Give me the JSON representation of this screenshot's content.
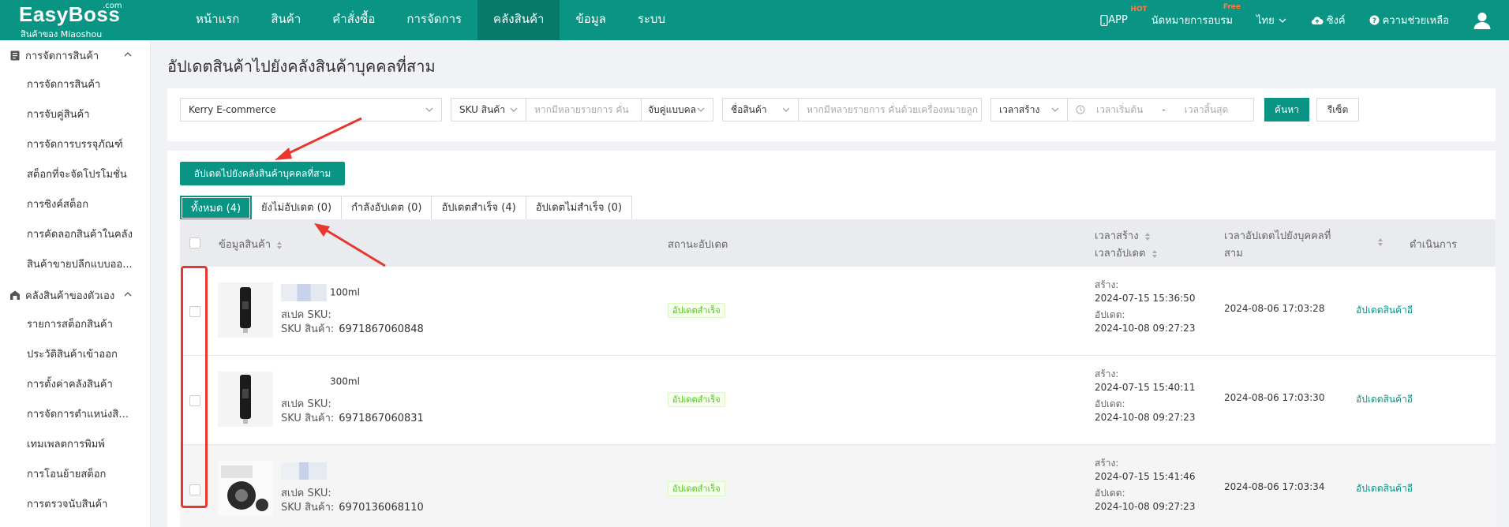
{
  "brand": {
    "name": "EasyBoss",
    "domain": ".com",
    "sub": "สินค้าของ Miaoshou"
  },
  "nav": [
    {
      "label": "หน้าแรก"
    },
    {
      "label": "สินค้า"
    },
    {
      "label": "คำสั่งซื้อ"
    },
    {
      "label": "การจัดการ"
    },
    {
      "label": "คลังสินค้า"
    },
    {
      "label": "ข้อมูล"
    },
    {
      "label": "ระบบ"
    }
  ],
  "topright": {
    "app": "APP",
    "app_badge": "HOT",
    "training": "นัดหมายการอบรม",
    "training_badge": "Free",
    "lang": "ไทย",
    "sync": "ซิงค์",
    "help": "ความช่วยเหลือ"
  },
  "sidebar": {
    "group1": {
      "label": "การจัดการสินค้า",
      "items": [
        {
          "label": "การจัดการสินค้า"
        },
        {
          "label": "การจับคู่สินค้า"
        },
        {
          "label": "การจัดการบรรจุภัณฑ์"
        },
        {
          "label": "สต็อกที่จะจัดโปรโมชั่น"
        },
        {
          "label": "การซิงค์สต็อก"
        },
        {
          "label": "การคัดลอกสินค้าในคลัง"
        },
        {
          "label": "สินค้าขายปลีกแบบออ..."
        }
      ]
    },
    "group2": {
      "label": "คลังสินค้าของตัวเอง",
      "items": [
        {
          "label": "รายการสต็อกสินค้า"
        },
        {
          "label": "ประวัติสินค้าเข้าออก"
        },
        {
          "label": "การตั้งค่าคลังสินค้า"
        },
        {
          "label": "การจัดการตำแหน่งสินค้า"
        },
        {
          "label": "เทมเพลตการพิมพ์"
        },
        {
          "label": "การโอนย้ายสต็อก"
        },
        {
          "label": "การตรวจนับสินค้า"
        }
      ]
    }
  },
  "page": {
    "title": "อัปเดตสินค้าไปยังคลังสินค้าบุคคลที่สาม"
  },
  "filters": {
    "warehouse": "Kerry E-commerce",
    "sku_type": "SKU สินค้า",
    "sku_placeholder": "หากมีหลายรายการ คั่น",
    "match_type": "จับคู่แบบคล",
    "name_type": "ชื่อสินค้า",
    "name_placeholder": "หากมีหลายรายการ คั่นด้วยเครื่องหมายลูก",
    "time_type": "เวลาสร้าง",
    "start_placeholder": "เวลาเริ่มต้น",
    "range_sep": "-",
    "end_placeholder": "เวลาสิ้นสุด",
    "search": "ค้นหา",
    "reset": "รีเซ็ต"
  },
  "actions": {
    "update_button": "อัปเดตไปยังคลังสินค้าบุคคลที่สาม"
  },
  "tabs": [
    {
      "label": "ทั้งหมด (4)"
    },
    {
      "label": "ยังไม่อัปเดต (0)"
    },
    {
      "label": "กำลังอัปเดต (0)"
    },
    {
      "label": "อัปเดตสำเร็จ (4)"
    },
    {
      "label": "อัปเดตไม่สำเร็จ (0)"
    }
  ],
  "table": {
    "headers": {
      "product": "ข้อมูลสินค้า",
      "status": "สถานะอัปเดต",
      "created": "เวลาสร้าง",
      "updated": "เวลาอัปเดต",
      "third_party_line1": "เวลาอัปเดตไปยังบุคคลที่",
      "third_party_line2": "สาม",
      "operation": "ดำเนินการ"
    },
    "labels": {
      "spec_sku": "สเปค SKU:",
      "product_sku": "SKU สินค้า:",
      "created": "สร้าง:",
      "updated": "อัปเดต:"
    },
    "rows": [
      {
        "name": "100ml",
        "product_sku": "6971867060848",
        "status": "อัปเดตสำเร็จ",
        "created": "2024-07-15 15:36:50",
        "updated": "2024-10-08 09:27:23",
        "third_party_time": "2024-08-06 17:03:28",
        "action": "อัปเดตสินค้าอี"
      },
      {
        "name": "300ml",
        "product_sku": "6971867060831",
        "status": "อัปเดตสำเร็จ",
        "created": "2024-07-15 15:40:11",
        "updated": "2024-10-08 09:27:23",
        "third_party_time": "2024-08-06 17:03:30",
        "action": "อัปเดตสินค้าอี"
      },
      {
        "name": "",
        "product_sku": "6970136068110",
        "status": "อัปเดตสำเร็จ",
        "created": "2024-07-15 15:41:46",
        "updated": "2024-10-08 09:27:23",
        "third_party_time": "2024-08-06 17:03:34",
        "action": "อัปเดตสินค้าอี"
      }
    ]
  },
  "colors": {
    "primary": "#0a9484",
    "primary_dark": "#077a6c",
    "annotation": "#e8372e",
    "success": "#52c41a"
  }
}
